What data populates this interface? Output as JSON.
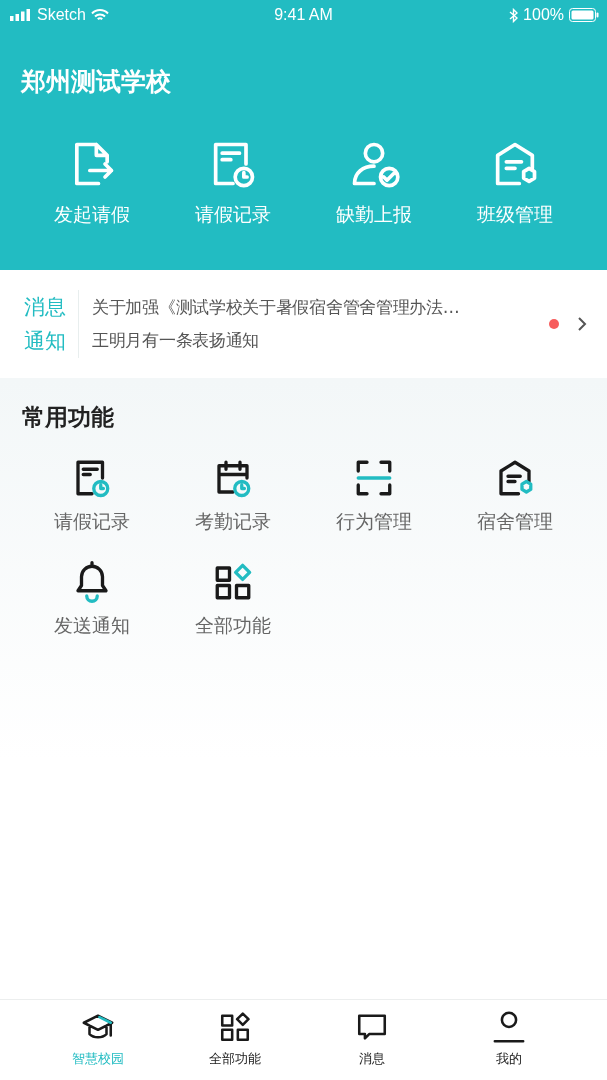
{
  "status_bar": {
    "carrier": "Sketch",
    "time": "9:41 AM",
    "battery": "100%"
  },
  "header": {
    "title": "郑州测试学校",
    "actions": [
      {
        "label": "发起请假",
        "kind": "doc-arrow"
      },
      {
        "label": "请假记录",
        "kind": "doc-clock"
      },
      {
        "label": "缺勤上报",
        "kind": "person-check"
      },
      {
        "label": "班级管理",
        "kind": "house-hex"
      }
    ]
  },
  "notice": {
    "badge_lines": [
      "消息",
      "通知"
    ],
    "lines": [
      "关于加强《测试学校关于暑假宿舍管舍管理办法…",
      "王明月有一条表扬通知"
    ],
    "unread": true
  },
  "common": {
    "title": "常用功能",
    "items": [
      {
        "label": "请假记录",
        "kind": "doc-clock"
      },
      {
        "label": "考勤记录",
        "kind": "calendar-clock"
      },
      {
        "label": "行为管理",
        "kind": "scan"
      },
      {
        "label": "宿舍管理",
        "kind": "house-hex"
      },
      {
        "label": "发送通知",
        "kind": "bell"
      },
      {
        "label": "全部功能",
        "kind": "grid"
      }
    ]
  },
  "tab_bar": [
    {
      "label": "智慧校园",
      "kind": "cap",
      "selected": true
    },
    {
      "label": "全部功能",
      "kind": "grid",
      "selected": false
    },
    {
      "label": "消息",
      "kind": "chat",
      "selected": false
    },
    {
      "label": "我的",
      "kind": "person",
      "selected": false
    }
  ]
}
